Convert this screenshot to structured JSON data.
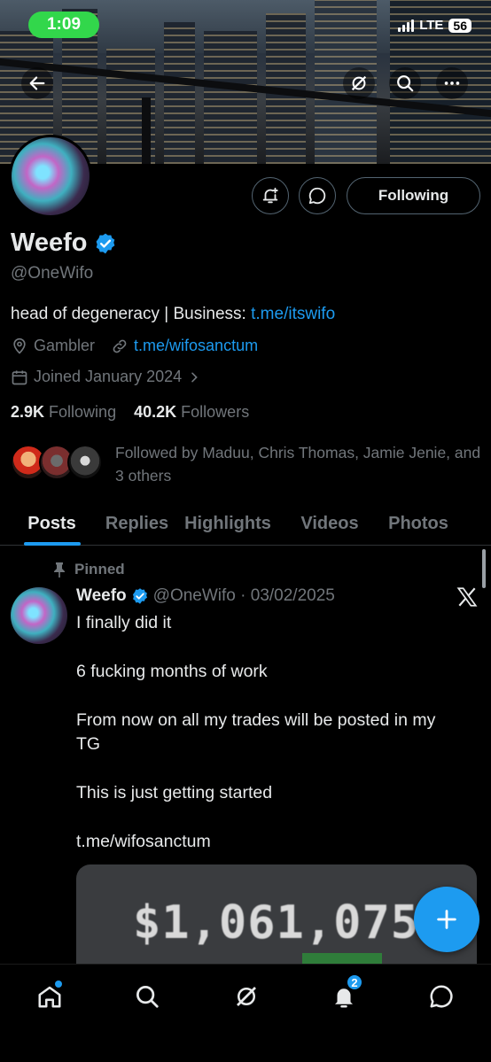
{
  "status_bar": {
    "time": "1:09",
    "network": "LTE",
    "battery": "56"
  },
  "profile": {
    "name": "Weefo",
    "handle": "@OneWifo",
    "bio_text": "head of degeneracy | Business: ",
    "bio_link": "t.me/itswifo",
    "location": "Gambler",
    "website": "t.me/wifosanctum",
    "joined": "Joined January 2024",
    "following_count": "2.9K",
    "following_label": "Following",
    "followers_count": "40.2K",
    "followers_label": "Followers",
    "followed_by": "Followed by Maduu, Chris Thomas, Jamie Jenie, and 3 others",
    "follow_button": "Following"
  },
  "tabs": [
    "Posts",
    "Replies",
    "Highlights",
    "Videos",
    "Photos"
  ],
  "post": {
    "pinned_label": "Pinned",
    "name": "Weefo",
    "handle_date": "@OneWifo · 03/02/2025",
    "lines": [
      "I finally did it",
      "6 fucking months of work",
      "From now on all my trades will be posted in my",
      "TG",
      "This is just getting started"
    ],
    "link": "t.me/wifosanctum",
    "media_amount": "$1,061,075.86"
  },
  "bottom_nav": {
    "notifications_badge": "2"
  },
  "colors": {
    "accent": "#1d9bf0",
    "background": "#000000",
    "muted": "#71767b",
    "status_pill": "#32d74b"
  },
  "icons": [
    "back-arrow-icon",
    "grok-icon",
    "search-icon",
    "more-icon",
    "bell-plus-icon",
    "message-icon",
    "verified-badge-icon",
    "location-icon",
    "link-icon",
    "calendar-icon",
    "chevron-right-icon",
    "pin-icon",
    "x-logo-icon",
    "plus-icon",
    "home-icon",
    "notifications-icon",
    "messages-icon"
  ]
}
